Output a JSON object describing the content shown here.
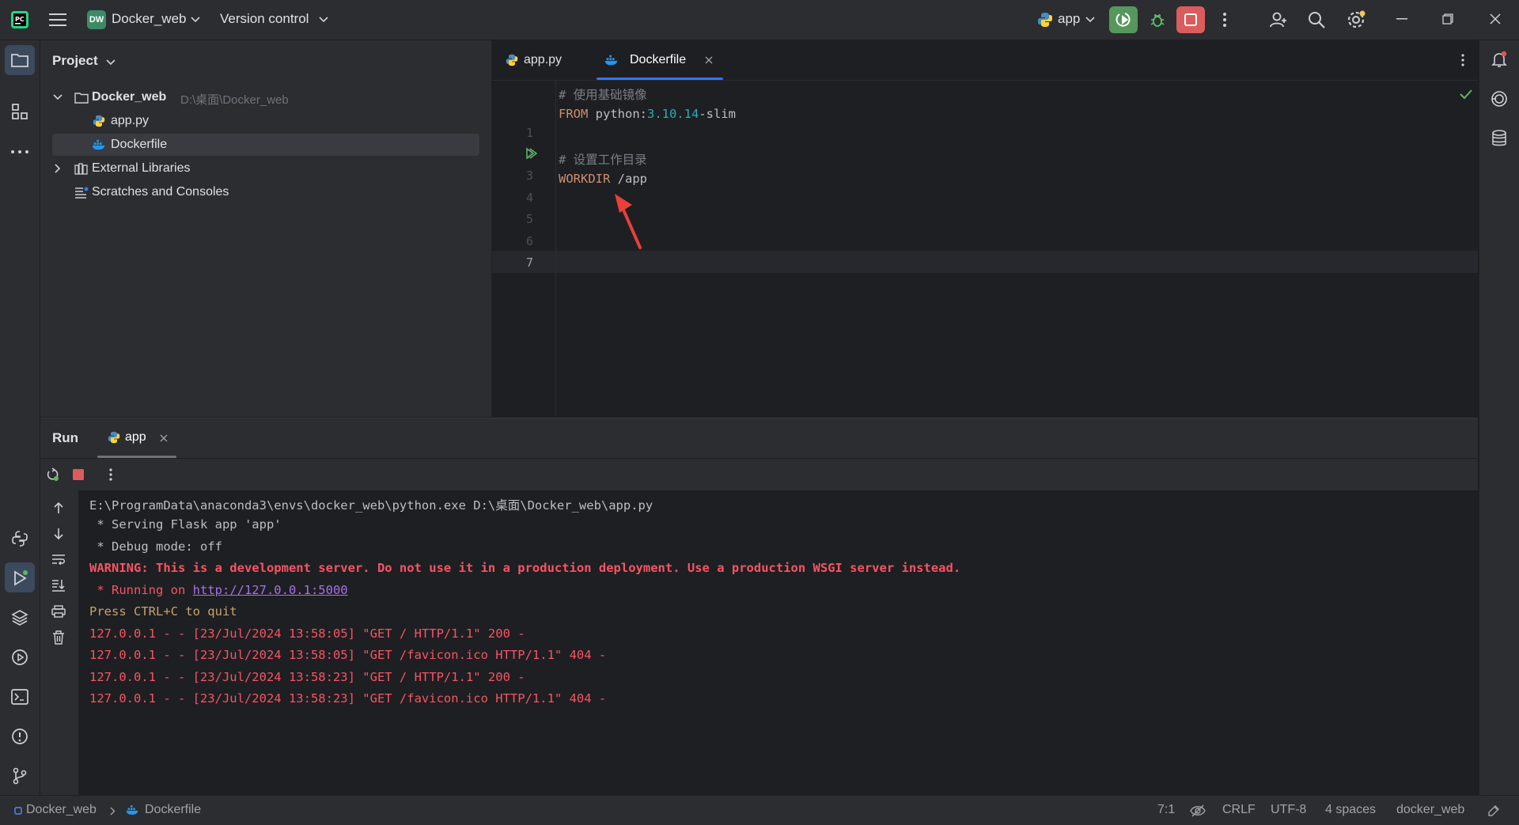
{
  "titlebar": {
    "project_badge": "DW",
    "project_name": "Docker_web",
    "version_control": "Version control",
    "run_config": "app"
  },
  "project_panel": {
    "title": "Project",
    "tree": [
      {
        "label": "Docker_web",
        "hint": "D:\\桌面\\Docker_web",
        "icon": "folder-icon"
      },
      {
        "label": "app.py",
        "icon": "python-file-icon"
      },
      {
        "label": "Dockerfile",
        "icon": "docker-file-icon",
        "selected": true
      },
      {
        "label": "External Libraries",
        "icon": "library-icon"
      },
      {
        "label": "Scratches and Consoles",
        "icon": "scratches-icon"
      }
    ]
  },
  "editor": {
    "tabs": [
      {
        "label": "app.py",
        "active": false
      },
      {
        "label": "Dockerfile",
        "active": true
      }
    ],
    "line_numbers": [
      "1",
      "2",
      "3",
      "4",
      "5",
      "6",
      "7"
    ],
    "lines": {
      "l1": "# 使用基础镜像",
      "l2_kw": "FROM",
      "l2_a": " python:",
      "l2_num": "3.10.14",
      "l2_b": "-slim",
      "l4": "# 设置工作目录",
      "l5_kw": "WORKDIR",
      "l5_a": " /app"
    },
    "annotation_color": "#e8403a"
  },
  "run_panel": {
    "title": "Run",
    "tab_label": "app",
    "console": {
      "cmd": "E:\\ProgramData\\anaconda3\\envs\\docker_web\\python.exe D:\\桌面\\Docker_web\\app.py",
      "serving": " * Serving Flask app 'app'",
      "debug": " * Debug mode: off",
      "warning": "WARNING: This is a development server. Do not use it in a production deployment. Use a production WSGI server instead.",
      "running_prefix": " * Running on ",
      "running_url": "http://127.0.0.1:5000",
      "quit": "Press CTRL+C to quit",
      "log1": "127.0.0.1 - - [23/Jul/2024 13:58:05] \"GET / HTTP/1.1\" 200 -",
      "log2": "127.0.0.1 - - [23/Jul/2024 13:58:05] \"GET /favicon.ico HTTP/1.1\" 404 -",
      "log3": "127.0.0.1 - - [23/Jul/2024 13:58:23] \"GET / HTTP/1.1\" 200 -",
      "log4": "127.0.0.1 - - [23/Jul/2024 13:58:23] \"GET /favicon.ico HTTP/1.1\" 404 -"
    }
  },
  "statusbar": {
    "crumb_project": "Docker_web",
    "crumb_file": "Dockerfile",
    "position": "7:1",
    "line_ending": "CRLF",
    "encoding": "UTF-8",
    "indent": "4 spaces",
    "interpreter": "docker_web"
  },
  "colors": {
    "accent": "#3574f0",
    "run_green": "#57965c",
    "stop_red": "#db5c5c"
  }
}
